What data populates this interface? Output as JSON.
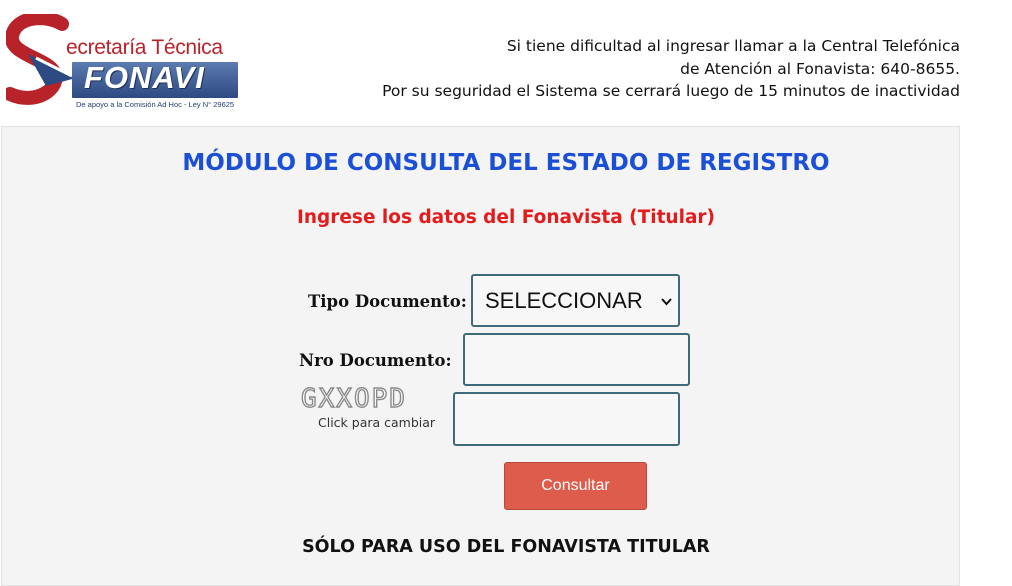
{
  "logo": {
    "title": "ecretaría Técnica",
    "brand": "FONAVI",
    "tagline": "De apoyo a la Comisión Ad Hoc - Ley N° 29625",
    "colors": {
      "red": "#b8232a",
      "blue": "#2d4a82"
    }
  },
  "help": {
    "line1": "Si tiene dificultad al ingresar llamar a la Central Telefónica",
    "line2": "de Atención al Fonavista: 640-8655.",
    "line3": "Por su seguridad el Sistema se cerrará luego de 15 minutos de inactividad"
  },
  "form": {
    "title": "MÓDULO DE CONSULTA DEL ESTADO DE REGISTRO",
    "subtitle": "Ingrese los datos del Fonavista (Titular)",
    "doc_type_label": "Tipo Documento:",
    "doc_type_value": "SELECCIONAR",
    "doc_number_label": "Nro Documento:",
    "doc_number_value": "",
    "captcha_code": "GXXOPD",
    "captcha_hint": "Click para cambiar",
    "captcha_value": "",
    "submit_label": "Consultar",
    "footer_note": "SÓLO PARA USO DEL FONAVISTA TITULAR"
  },
  "colors": {
    "title_blue": "#1b4fd6",
    "subtitle_red": "#e31b1b",
    "button": "#dd5c4b",
    "input_border": "#3f6a7a",
    "panel_bg": "#f4f4f4"
  },
  "icons": {
    "select_arrow": "chevron-down-icon"
  }
}
